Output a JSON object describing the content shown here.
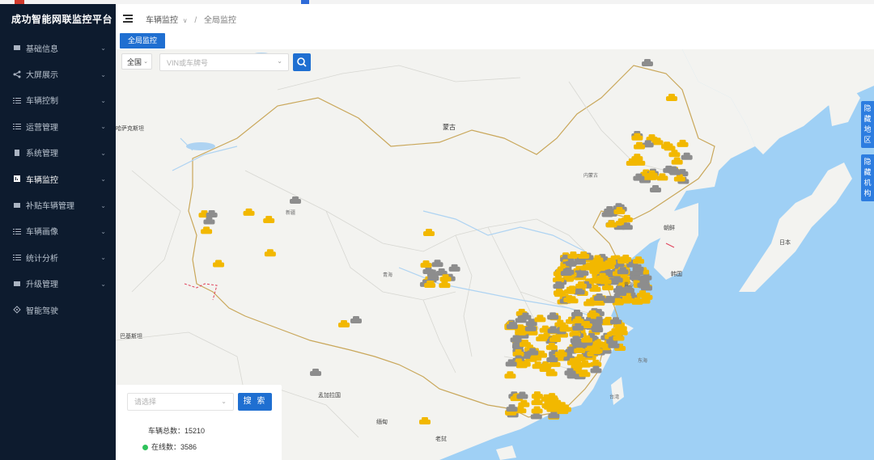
{
  "app": {
    "title": "成功智能网联监控平台"
  },
  "sidebar": {
    "items": [
      {
        "label": "基础信息",
        "icon": "grid-icon",
        "expandable": true
      },
      {
        "label": "大屏展示",
        "icon": "share-icon",
        "expandable": true
      },
      {
        "label": "车辆控制",
        "icon": "list-icon",
        "expandable": true
      },
      {
        "label": "运营管理",
        "icon": "list-icon",
        "expandable": true
      },
      {
        "label": "系统管理",
        "icon": "document-icon",
        "expandable": true
      },
      {
        "label": "车辆监控",
        "icon": "chart-icon",
        "expandable": true,
        "active": true
      },
      {
        "label": "补贴车辆管理",
        "icon": "grid-icon",
        "expandable": true
      },
      {
        "label": "车辆画像",
        "icon": "list-icon",
        "expandable": true
      },
      {
        "label": "统计分析",
        "icon": "list-icon",
        "expandable": true
      },
      {
        "label": "升级管理",
        "icon": "grid-icon",
        "expandable": true
      },
      {
        "label": "智能驾驶",
        "icon": "diamond-icon",
        "expandable": false
      }
    ]
  },
  "breadcrumb": {
    "parent": "车辆监控",
    "separator": "/",
    "current": "全局监控"
  },
  "tabs": {
    "active": "全局监控"
  },
  "map_search": {
    "region_value": "全国",
    "vin_placeholder": "VIN或车牌号"
  },
  "side_toggles": {
    "region": "隐藏地区",
    "org": "隐藏机构"
  },
  "stats": {
    "select_placeholder": "请选择",
    "search_label": "搜 索",
    "total_label": "车辆总数：",
    "total_value": "15210",
    "online_label": "在线数：",
    "online_value": "3586",
    "online_color": "#2ec25b"
  },
  "map_labels": [
    {
      "text": "蒙古",
      "cls": "big"
    },
    {
      "text": "朝鲜",
      "cls": ""
    },
    {
      "text": "韩国",
      "cls": ""
    },
    {
      "text": "日本",
      "cls": ""
    },
    {
      "text": "哈萨克斯坦",
      "cls": ""
    },
    {
      "text": "巴基斯坦",
      "cls": ""
    },
    {
      "text": "孟加拉国",
      "cls": ""
    },
    {
      "text": "缅甸",
      "cls": ""
    },
    {
      "text": "老挝",
      "cls": ""
    },
    {
      "text": "新疆",
      "cls": "sm"
    },
    {
      "text": "青海",
      "cls": "sm"
    },
    {
      "text": "内蒙古",
      "cls": "sm"
    },
    {
      "text": "黄海",
      "cls": "sm"
    },
    {
      "text": "东海",
      "cls": "sm"
    },
    {
      "text": "台湾",
      "cls": "sm"
    }
  ],
  "colors": {
    "sidebar_bg": "#0d1b2e",
    "accent": "#1f6fd1",
    "car_online": "#f2b800",
    "car_offline": "#8d8d8d",
    "sea": "#9fd0f5",
    "land": "#f3f3f0"
  }
}
